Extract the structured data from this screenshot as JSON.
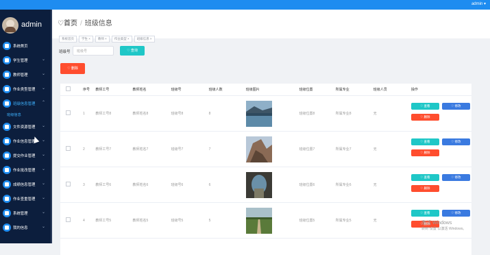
{
  "topbar": {
    "user": "admin ▾"
  },
  "brand": {
    "title": "admin"
  },
  "menu": [
    {
      "label": "系统首页",
      "arrow": ""
    },
    {
      "label": "学生管理",
      "arrow": "⌄"
    },
    {
      "label": "教师管理",
      "arrow": "⌄"
    },
    {
      "label": "作业类型管理",
      "arrow": "⌄"
    },
    {
      "label": "班级信息管理",
      "arrow": "⌃",
      "active": true,
      "sub": "班级信息"
    },
    {
      "label": "文件资源管理",
      "arrow": "⌄"
    },
    {
      "label": "作业信息管理",
      "arrow": "⌄"
    },
    {
      "label": "提交作业管理",
      "arrow": "⌄"
    },
    {
      "label": "作业批改管理",
      "arrow": "⌄"
    },
    {
      "label": "成绩信息管理",
      "arrow": "⌄"
    },
    {
      "label": "作业查重管理",
      "arrow": "⌄"
    },
    {
      "label": "系统管理",
      "arrow": "⌄"
    },
    {
      "label": "我的信息",
      "arrow": "⌄"
    }
  ],
  "breadcrumb": {
    "home": "首页",
    "sep": "/",
    "current": "班级信息"
  },
  "tags": [
    "系统首页",
    "学生 ×",
    "教师 ×",
    "作业类型 ×",
    "班级信息 ×"
  ],
  "search": {
    "label": "班级号",
    "placeholder": "班级号",
    "query_button": "♡ 查询"
  },
  "delete_button": "♡ 删除",
  "table": {
    "headers": [
      "",
      "序号",
      "教师工号",
      "教师姓名",
      "班级号",
      "班级人数",
      "班级图片",
      "班级位置",
      "所属专业",
      "班级人员",
      "操作"
    ],
    "rows": [
      {
        "no": "1",
        "tid": "教师工号8",
        "tname": "教师姓名8",
        "cls": "班级号8",
        "count": "8",
        "pos": "班级位置8",
        "major": "所属专业8",
        "members": "无",
        "img": "lake"
      },
      {
        "no": "2",
        "tid": "教师工号7",
        "tname": "教师姓名7",
        "cls": "班级号7",
        "count": "7",
        "pos": "班级位置7",
        "major": "所属专业7",
        "members": "无",
        "img": "rock"
      },
      {
        "no": "3",
        "tid": "教师工号6",
        "tname": "教师姓名6",
        "cls": "班级号6",
        "count": "6",
        "pos": "班级位置6",
        "major": "所属专业6",
        "members": "无",
        "img": "cave"
      },
      {
        "no": "4",
        "tid": "教师工号5",
        "tname": "教师姓名5",
        "cls": "班级号5",
        "count": "5",
        "pos": "班级位置5",
        "major": "所属专业5",
        "members": "无",
        "img": "path"
      }
    ],
    "ops": {
      "view": "♡ 查看",
      "edit": "♡ 修改",
      "del": "♡ 删除"
    }
  },
  "watermark": {
    "line1": "激活 Windows",
    "line2": "转到\"设置\"以激活 Windows。"
  }
}
